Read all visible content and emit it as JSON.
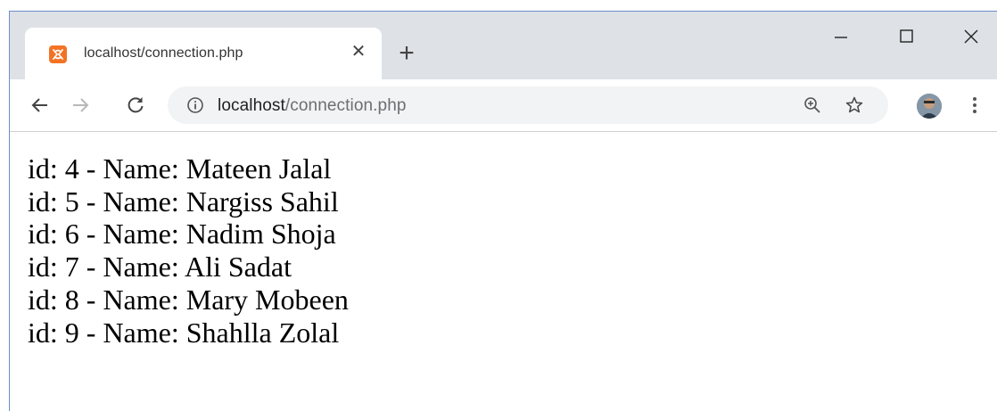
{
  "tab": {
    "title": "localhost/connection.php",
    "close_glyph": "✕",
    "new_tab_glyph": "+"
  },
  "address_bar": {
    "host": "localhost",
    "path": "/connection.php"
  },
  "window_controls": {
    "minimize": "—",
    "maximize": "☐",
    "close": "✕"
  },
  "icons": {
    "favicon": "xampp-icon",
    "back": "back-arrow-icon",
    "forward": "forward-arrow-icon",
    "reload": "reload-icon",
    "info": "info-icon",
    "zoom": "zoom-icon",
    "bookmark": "star-icon",
    "profile": "avatar",
    "menu": "kebab-menu-icon"
  },
  "colors": {
    "tabstrip": "#dee1e6",
    "omnibox": "#f1f3f4",
    "favicon": "#f37325"
  },
  "records": [
    "id: 4 - Name: Mateen Jalal",
    "id: 5 - Name: Nargiss Sahil",
    "id: 6 - Name: Nadim Shoja",
    "id: 7 - Name: Ali Sadat",
    "id: 8 - Name: Mary Mobeen",
    "id: 9 - Name: Shahlla Zolal"
  ]
}
